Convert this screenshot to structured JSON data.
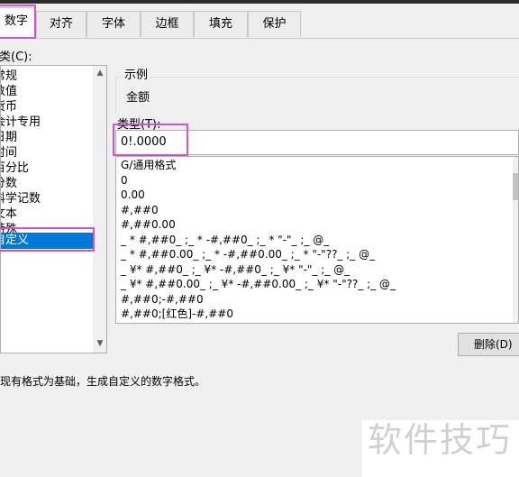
{
  "tabs": [
    {
      "label": "数字",
      "active": true
    },
    {
      "label": "对齐",
      "active": false
    },
    {
      "label": "字体",
      "active": false
    },
    {
      "label": "边框",
      "active": false
    },
    {
      "label": "填充",
      "active": false
    },
    {
      "label": "保护",
      "active": false
    }
  ],
  "category": {
    "label": "分类(C):",
    "items": [
      "常规",
      "数值",
      "货币",
      "会计专用",
      "日期",
      "时间",
      "百分比",
      "分数",
      "科学记数",
      "文本",
      "特殊",
      "自定义"
    ],
    "selected": "自定义"
  },
  "sample": {
    "group_label": "示例",
    "value": "金额"
  },
  "type": {
    "label": "类型(T):",
    "value": "0!.0000"
  },
  "formats": [
    "G/通用格式",
    "0",
    "0.00",
    "#,##0",
    "#,##0.00",
    "_ * #,##0_ ;_ * -#,##0_ ;_ * \"-\"_ ;_ @_",
    "_ * #,##0.00_ ;_ * -#,##0.00_ ;_ * \"-\"??_ ;_ @_",
    "_ ¥* #,##0_ ;_ ¥* -#,##0_ ;_ ¥* \"-\"_ ;_ @_",
    "_ ¥* #,##0.00_ ;_ ¥* -#,##0.00_ ;_ ¥* \"-\"??_ ;_ @_",
    "#,##0;-#,##0",
    "#,##0;[红色]-#,##0"
  ],
  "delete_button": "删除(D)",
  "description": "以现有格式为基础，生成自定义的数字格式。",
  "watermark": "软件技巧",
  "colors": {
    "highlight": "#d54fd5",
    "selection": "#0078d7"
  }
}
